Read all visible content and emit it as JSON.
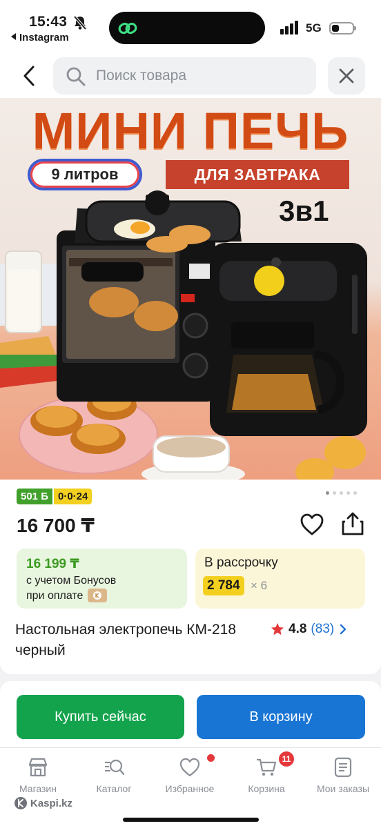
{
  "status_bar": {
    "time": "15:43",
    "back_app": "Instagram",
    "network": "5G",
    "battery_level": 0.35
  },
  "search": {
    "placeholder": "Поиск товара"
  },
  "banner": {
    "headline": "МИНИ ПЕЧЬ",
    "capacity": "9 литров",
    "subtitle": "ДЛЯ ЗАВТРАКА",
    "combo": "3в1"
  },
  "product": {
    "bonus_tag": "501 Б",
    "installment_tag": "0·0·24",
    "image_count": 5,
    "current_image": 1,
    "price": "16 700 ₸",
    "bonus_price": "16 199 ₸",
    "bonus_line1": "с учетом Бонусов",
    "bonus_line2": "при оплате",
    "installment_label": "В рассрочку",
    "installment_amount": "2 784",
    "installment_months": "× 6",
    "title": "Настольная электропечь КМ-218 черный",
    "rating": "4.8",
    "reviews": "(83)"
  },
  "actions": {
    "buy_now": "Купить сейчас",
    "add_to_cart": "В корзину"
  },
  "tabbar": {
    "items": [
      {
        "label": "Магазин",
        "icon": "store-icon"
      },
      {
        "label": "Каталог",
        "icon": "catalog-search-icon"
      },
      {
        "label": "Избранное",
        "icon": "heart-icon"
      },
      {
        "label": "Корзина",
        "icon": "cart-icon"
      },
      {
        "label": "Мои заказы",
        "icon": "orders-icon"
      }
    ],
    "cart_count": "11",
    "domain": "Kaspi.kz"
  },
  "colors": {
    "green": "#13a34d",
    "blue": "#1975d4",
    "accent_red": "#e5383b",
    "tag_yellow": "#f3d01f"
  }
}
